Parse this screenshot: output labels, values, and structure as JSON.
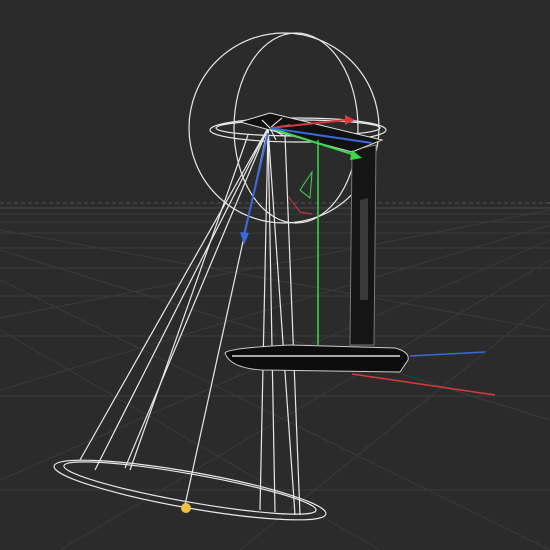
{
  "viewport": {
    "kind": "3d-viewport",
    "background": "#2b2b2b",
    "grid_color": "#3a3a3a",
    "horizon_color": "#5a5a5a"
  },
  "scene": {
    "object": "desk-lamp",
    "light_type": "spot-light",
    "wireframe_color": "#e8e8e8",
    "lamp_body_color": "#1a1a1a"
  },
  "gizmo": {
    "x_axis_color": "#d83a3a",
    "y_axis_color": "#3ad84a",
    "z_axis_color": "#3a6ad8",
    "handle_color": "#f0c040"
  }
}
